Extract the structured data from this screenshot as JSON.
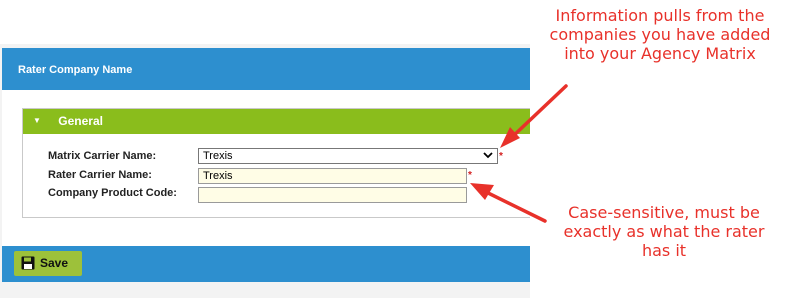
{
  "dialog": {
    "title": "Rater Company Name",
    "section_title": "General",
    "fields": {
      "matrix_carrier_label": "Matrix Carrier Name:",
      "matrix_carrier_value": "Trexis",
      "rater_carrier_label": "Rater Carrier Name:",
      "rater_carrier_value": "Trexis",
      "product_code_label": "Company Product Code:",
      "product_code_value": ""
    },
    "required_marker": "*",
    "save_label": "Save"
  },
  "annotations": {
    "top_note": [
      "Information pulls from the",
      "companies you have added",
      "into your Agency Matrix"
    ],
    "bottom_note": [
      "Case-sensitive, must be",
      "exactly as what the rater",
      "has it"
    ]
  },
  "colors": {
    "header_blue": "#2d8fcf",
    "section_green": "#8abd1c",
    "save_green": "#9dc13a",
    "input_yellow": "#fffde6",
    "annotation_red": "#e8312a"
  },
  "icons": {
    "section_toggle": "caret-down-icon",
    "dropdown": "chevron-down-icon",
    "save": "floppy-disk-icon"
  }
}
